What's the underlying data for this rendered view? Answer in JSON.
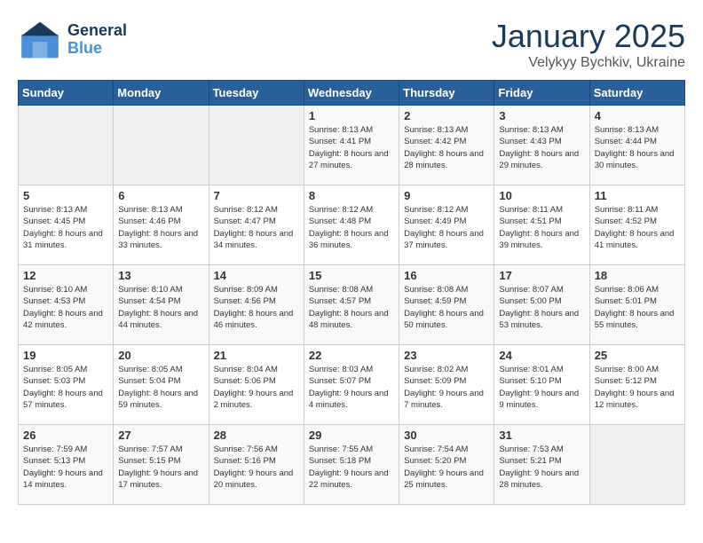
{
  "header": {
    "logo_line1": "General",
    "logo_line2": "Blue",
    "title": "January 2025",
    "subtitle": "Velykyy Bychkiv, Ukraine"
  },
  "days_of_week": [
    "Sunday",
    "Monday",
    "Tuesday",
    "Wednesday",
    "Thursday",
    "Friday",
    "Saturday"
  ],
  "weeks": [
    [
      {
        "day": "",
        "info": ""
      },
      {
        "day": "",
        "info": ""
      },
      {
        "day": "",
        "info": ""
      },
      {
        "day": "1",
        "info": "Sunrise: 8:13 AM\nSunset: 4:41 PM\nDaylight: 8 hours and 27 minutes."
      },
      {
        "day": "2",
        "info": "Sunrise: 8:13 AM\nSunset: 4:42 PM\nDaylight: 8 hours and 28 minutes."
      },
      {
        "day": "3",
        "info": "Sunrise: 8:13 AM\nSunset: 4:43 PM\nDaylight: 8 hours and 29 minutes."
      },
      {
        "day": "4",
        "info": "Sunrise: 8:13 AM\nSunset: 4:44 PM\nDaylight: 8 hours and 30 minutes."
      }
    ],
    [
      {
        "day": "5",
        "info": "Sunrise: 8:13 AM\nSunset: 4:45 PM\nDaylight: 8 hours and 31 minutes."
      },
      {
        "day": "6",
        "info": "Sunrise: 8:13 AM\nSunset: 4:46 PM\nDaylight: 8 hours and 33 minutes."
      },
      {
        "day": "7",
        "info": "Sunrise: 8:12 AM\nSunset: 4:47 PM\nDaylight: 8 hours and 34 minutes."
      },
      {
        "day": "8",
        "info": "Sunrise: 8:12 AM\nSunset: 4:48 PM\nDaylight: 8 hours and 36 minutes."
      },
      {
        "day": "9",
        "info": "Sunrise: 8:12 AM\nSunset: 4:49 PM\nDaylight: 8 hours and 37 minutes."
      },
      {
        "day": "10",
        "info": "Sunrise: 8:11 AM\nSunset: 4:51 PM\nDaylight: 8 hours and 39 minutes."
      },
      {
        "day": "11",
        "info": "Sunrise: 8:11 AM\nSunset: 4:52 PM\nDaylight: 8 hours and 41 minutes."
      }
    ],
    [
      {
        "day": "12",
        "info": "Sunrise: 8:10 AM\nSunset: 4:53 PM\nDaylight: 8 hours and 42 minutes."
      },
      {
        "day": "13",
        "info": "Sunrise: 8:10 AM\nSunset: 4:54 PM\nDaylight: 8 hours and 44 minutes."
      },
      {
        "day": "14",
        "info": "Sunrise: 8:09 AM\nSunset: 4:56 PM\nDaylight: 8 hours and 46 minutes."
      },
      {
        "day": "15",
        "info": "Sunrise: 8:08 AM\nSunset: 4:57 PM\nDaylight: 8 hours and 48 minutes."
      },
      {
        "day": "16",
        "info": "Sunrise: 8:08 AM\nSunset: 4:59 PM\nDaylight: 8 hours and 50 minutes."
      },
      {
        "day": "17",
        "info": "Sunrise: 8:07 AM\nSunset: 5:00 PM\nDaylight: 8 hours and 53 minutes."
      },
      {
        "day": "18",
        "info": "Sunrise: 8:06 AM\nSunset: 5:01 PM\nDaylight: 8 hours and 55 minutes."
      }
    ],
    [
      {
        "day": "19",
        "info": "Sunrise: 8:05 AM\nSunset: 5:03 PM\nDaylight: 8 hours and 57 minutes."
      },
      {
        "day": "20",
        "info": "Sunrise: 8:05 AM\nSunset: 5:04 PM\nDaylight: 8 hours and 59 minutes."
      },
      {
        "day": "21",
        "info": "Sunrise: 8:04 AM\nSunset: 5:06 PM\nDaylight: 9 hours and 2 minutes."
      },
      {
        "day": "22",
        "info": "Sunrise: 8:03 AM\nSunset: 5:07 PM\nDaylight: 9 hours and 4 minutes."
      },
      {
        "day": "23",
        "info": "Sunrise: 8:02 AM\nSunset: 5:09 PM\nDaylight: 9 hours and 7 minutes."
      },
      {
        "day": "24",
        "info": "Sunrise: 8:01 AM\nSunset: 5:10 PM\nDaylight: 9 hours and 9 minutes."
      },
      {
        "day": "25",
        "info": "Sunrise: 8:00 AM\nSunset: 5:12 PM\nDaylight: 9 hours and 12 minutes."
      }
    ],
    [
      {
        "day": "26",
        "info": "Sunrise: 7:59 AM\nSunset: 5:13 PM\nDaylight: 9 hours and 14 minutes."
      },
      {
        "day": "27",
        "info": "Sunrise: 7:57 AM\nSunset: 5:15 PM\nDaylight: 9 hours and 17 minutes."
      },
      {
        "day": "28",
        "info": "Sunrise: 7:56 AM\nSunset: 5:16 PM\nDaylight: 9 hours and 20 minutes."
      },
      {
        "day": "29",
        "info": "Sunrise: 7:55 AM\nSunset: 5:18 PM\nDaylight: 9 hours and 22 minutes."
      },
      {
        "day": "30",
        "info": "Sunrise: 7:54 AM\nSunset: 5:20 PM\nDaylight: 9 hours and 25 minutes."
      },
      {
        "day": "31",
        "info": "Sunrise: 7:53 AM\nSunset: 5:21 PM\nDaylight: 9 hours and 28 minutes."
      },
      {
        "day": "",
        "info": ""
      }
    ]
  ]
}
